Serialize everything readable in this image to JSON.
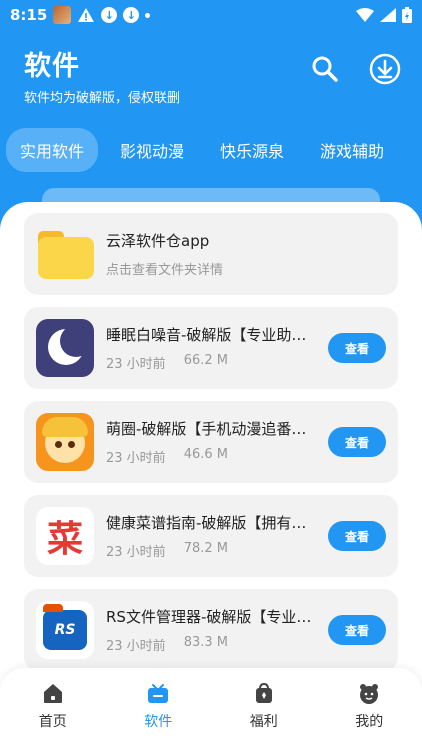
{
  "status_bar": {
    "time": "8:15"
  },
  "header": {
    "title": "软件",
    "subtitle": "软件均为破解版，侵权联删"
  },
  "tabs": [
    {
      "label": "实用软件",
      "active": true
    },
    {
      "label": "影视动漫",
      "active": false
    },
    {
      "label": "快乐源泉",
      "active": false
    },
    {
      "label": "游戏辅助",
      "active": false
    }
  ],
  "folder_card": {
    "title": "云泽软件仓app",
    "subtitle": "点击查看文件夹详情"
  },
  "apps": [
    {
      "title": "睡眠白噪音-破解版【专业助眠放松】",
      "time": "23 小时前",
      "size": "66.2 M",
      "icon": "sleep-moon-icon",
      "button": "查看"
    },
    {
      "title": "萌圈-破解版【手机动漫追番神器】",
      "time": "23 小时前",
      "size": "46.6 M",
      "icon": "anime-girl-icon",
      "button": "查看"
    },
    {
      "title": "健康菜谱指南-破解版【拥有海量菜谱】",
      "time": "23 小时前",
      "size": "78.2 M",
      "icon": "recipe-cai-icon",
      "button": "查看"
    },
    {
      "title": "RS文件管理器-破解版【专业文件管理】",
      "time": "23 小时前",
      "size": "83.3 M",
      "icon": "rs-file-manager-icon",
      "button": "查看"
    }
  ],
  "icon_texts": {
    "cai": "菜",
    "rs": "RS"
  },
  "bottom_nav": [
    {
      "label": "首页",
      "icon": "home-icon",
      "active": false
    },
    {
      "label": "软件",
      "icon": "software-bag-icon",
      "active": true
    },
    {
      "label": "福利",
      "icon": "gift-bag-icon",
      "active": false
    },
    {
      "label": "我的",
      "icon": "profile-icon",
      "active": false
    }
  ],
  "colors": {
    "primary": "#2196f3",
    "card_bg": "#f2f2f2",
    "muted_text": "#999999"
  }
}
